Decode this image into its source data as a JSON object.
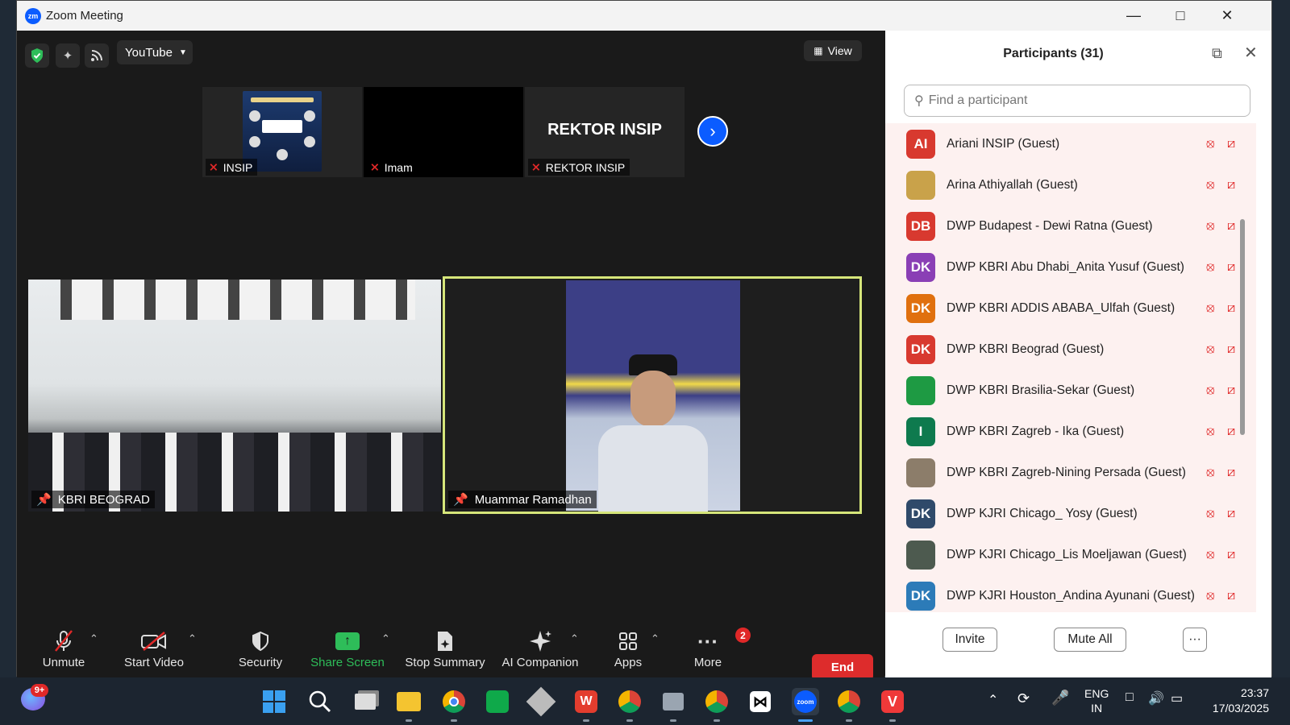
{
  "window": {
    "title": "Zoom Meeting",
    "logo": "zm"
  },
  "meeting_topbar": {
    "stream_label": "YouTube",
    "view_label": "View"
  },
  "thumbnails": [
    {
      "name": "INSIP"
    },
    {
      "name": "Imam"
    },
    {
      "name": "REKTOR INSIP",
      "display_text": "REKTOR INSIP"
    }
  ],
  "videos": [
    {
      "name": "KBRI BEOGRAD"
    },
    {
      "name": "Muammar Ramadhan"
    }
  ],
  "toolbar": {
    "unmute": "Unmute",
    "start_video": "Start Video",
    "security": "Security",
    "share_screen": "Share Screen",
    "stop_summary": "Stop Summary",
    "ai_companion": "AI Companion",
    "apps": "Apps",
    "more": "More",
    "more_badge": "2",
    "end": "End"
  },
  "participants_panel": {
    "title": "Participants (31)",
    "search_placeholder": "Find a participant",
    "invite": "Invite",
    "mute_all": "Mute All",
    "more": "···",
    "items": [
      {
        "initials": "AI",
        "color": "#d8392f",
        "name": "Ariani INSIP (Guest)"
      },
      {
        "initials": "",
        "color": "#c9a24a",
        "name": "Arina Athiyallah (Guest)"
      },
      {
        "initials": "DB",
        "color": "#d8392f",
        "name": "DWP Budapest - Dewi Ratna (Guest)"
      },
      {
        "initials": "DK",
        "color": "#8a3fb5",
        "name": "DWP KBRI Abu Dhabi_Anita Yusuf (Guest)"
      },
      {
        "initials": "DK",
        "color": "#e0700e",
        "name": "DWP KBRI ADDIS ABABA_Ulfah (Guest)"
      },
      {
        "initials": "DK",
        "color": "#d8392f",
        "name": "DWP KBRI Beograd (Guest)"
      },
      {
        "initials": "",
        "color": "#1e9a43",
        "name": "DWP KBRI Brasilia-Sekar (Guest)"
      },
      {
        "initials": "I",
        "color": "#0e7a4e",
        "name": "DWP KBRI Zagreb - Ika (Guest)"
      },
      {
        "initials": "",
        "color": "#8c7d6a",
        "name": "DWP KBRI Zagreb-Nining Persada (Guest)"
      },
      {
        "initials": "DK",
        "color": "#2f4a6a",
        "name": "DWP KJRI Chicago_ Yosy (Guest)"
      },
      {
        "initials": "",
        "color": "#4d5a4f",
        "name": "DWP KJRI Chicago_Lis Moeljawan (Guest)"
      },
      {
        "initials": "DK",
        "color": "#2c7bb8",
        "name": "DWP KJRI Houston_Andina Ayunani (Guest)"
      }
    ]
  },
  "taskbar": {
    "notification_badge": "9+",
    "language_line1": "ENG",
    "language_line2": "IN",
    "time": "23:37",
    "date": "17/03/2025"
  }
}
